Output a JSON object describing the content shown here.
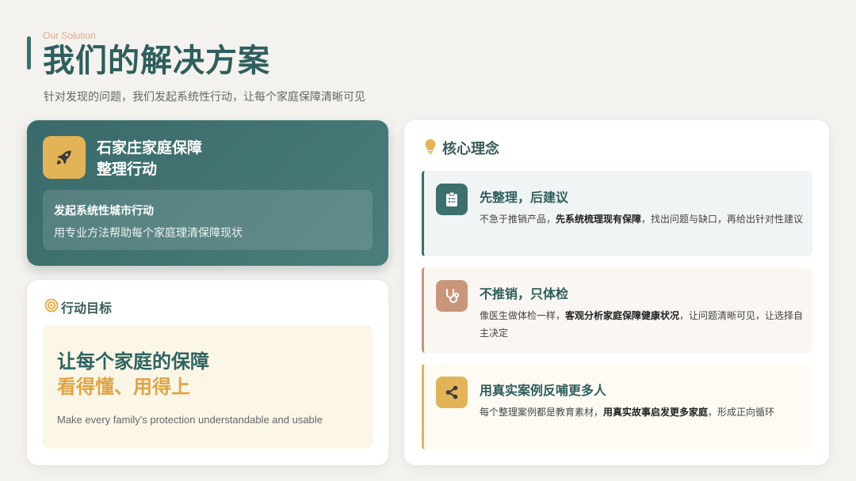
{
  "header": {
    "eyebrow": "Our Solution",
    "title": "我们的解决方案",
    "subtitle": "针对发现的问题，我们发起系统性行动，让每个家庭保障清晰可见"
  },
  "hero": {
    "icon": "rocket-icon",
    "title_line1": "石家庄家庭保障",
    "title_line2": "整理行动",
    "inner_title": "发起系统性城市行动",
    "inner_desc": "用专业方法帮助每个家庭理清保障现状"
  },
  "goal": {
    "icon": "target-icon",
    "label": "行动目标",
    "line1": "让每个家庭的保障",
    "line2": "看得懂、用得上",
    "english": "Make every family's protection understandable and usable"
  },
  "core": {
    "icon": "lightbulb-icon",
    "label": "核心理念",
    "items": [
      {
        "icon": "clipboard-icon",
        "title": "先整理，后建议",
        "desc_pre": "不急于推销产品，",
        "desc_bold": "先系统梳理现有保障",
        "desc_post": "，找出问题与缺口，再给出针对性建议"
      },
      {
        "icon": "stethoscope-icon",
        "title": "不推销，只体检",
        "desc_pre": "像医生做体检一样，",
        "desc_bold": "客观分析家庭保障健康状况",
        "desc_post": "，让问题清晰可见，让选择自主决定"
      },
      {
        "icon": "share-icon",
        "title": "用真实案例反哺更多人",
        "desc_pre": "每个整理案例都是教育素材，",
        "desc_bold": "用真实故事启发更多家庭",
        "desc_post": "，形成正向循环"
      }
    ]
  },
  "colors": {
    "primary_teal": "#3d6f6e",
    "accent_gold": "#e3b358",
    "accent_clay": "#c9957b",
    "background": "#f4f2ee"
  }
}
